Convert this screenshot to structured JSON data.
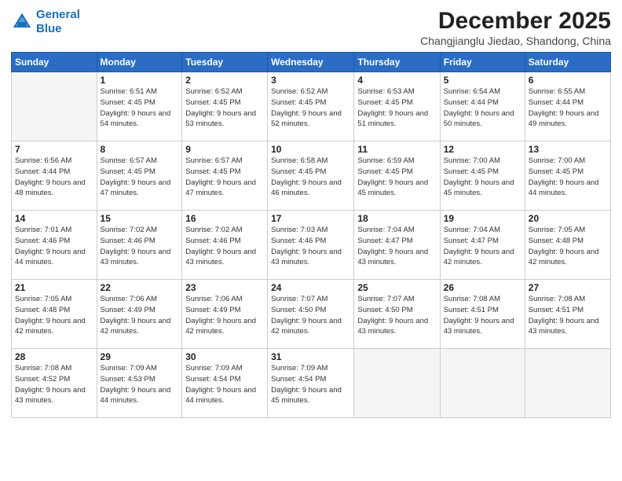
{
  "logo": {
    "line1": "General",
    "line2": "Blue"
  },
  "title": "December 2025",
  "subtitle": "Changjianglu Jiedao, Shandong, China",
  "days_header": [
    "Sunday",
    "Monday",
    "Tuesday",
    "Wednesday",
    "Thursday",
    "Friday",
    "Saturday"
  ],
  "weeks": [
    [
      {
        "day": "",
        "sunrise": "",
        "sunset": "",
        "daylight": ""
      },
      {
        "day": "1",
        "sunrise": "Sunrise: 6:51 AM",
        "sunset": "Sunset: 4:45 PM",
        "daylight": "Daylight: 9 hours and 54 minutes."
      },
      {
        "day": "2",
        "sunrise": "Sunrise: 6:52 AM",
        "sunset": "Sunset: 4:45 PM",
        "daylight": "Daylight: 9 hours and 53 minutes."
      },
      {
        "day": "3",
        "sunrise": "Sunrise: 6:52 AM",
        "sunset": "Sunset: 4:45 PM",
        "daylight": "Daylight: 9 hours and 52 minutes."
      },
      {
        "day": "4",
        "sunrise": "Sunrise: 6:53 AM",
        "sunset": "Sunset: 4:45 PM",
        "daylight": "Daylight: 9 hours and 51 minutes."
      },
      {
        "day": "5",
        "sunrise": "Sunrise: 6:54 AM",
        "sunset": "Sunset: 4:44 PM",
        "daylight": "Daylight: 9 hours and 50 minutes."
      },
      {
        "day": "6",
        "sunrise": "Sunrise: 6:55 AM",
        "sunset": "Sunset: 4:44 PM",
        "daylight": "Daylight: 9 hours and 49 minutes."
      }
    ],
    [
      {
        "day": "7",
        "sunrise": "Sunrise: 6:56 AM",
        "sunset": "Sunset: 4:44 PM",
        "daylight": "Daylight: 9 hours and 48 minutes."
      },
      {
        "day": "8",
        "sunrise": "Sunrise: 6:57 AM",
        "sunset": "Sunset: 4:45 PM",
        "daylight": "Daylight: 9 hours and 47 minutes."
      },
      {
        "day": "9",
        "sunrise": "Sunrise: 6:57 AM",
        "sunset": "Sunset: 4:45 PM",
        "daylight": "Daylight: 9 hours and 47 minutes."
      },
      {
        "day": "10",
        "sunrise": "Sunrise: 6:58 AM",
        "sunset": "Sunset: 4:45 PM",
        "daylight": "Daylight: 9 hours and 46 minutes."
      },
      {
        "day": "11",
        "sunrise": "Sunrise: 6:59 AM",
        "sunset": "Sunset: 4:45 PM",
        "daylight": "Daylight: 9 hours and 45 minutes."
      },
      {
        "day": "12",
        "sunrise": "Sunrise: 7:00 AM",
        "sunset": "Sunset: 4:45 PM",
        "daylight": "Daylight: 9 hours and 45 minutes."
      },
      {
        "day": "13",
        "sunrise": "Sunrise: 7:00 AM",
        "sunset": "Sunset: 4:45 PM",
        "daylight": "Daylight: 9 hours and 44 minutes."
      }
    ],
    [
      {
        "day": "14",
        "sunrise": "Sunrise: 7:01 AM",
        "sunset": "Sunset: 4:46 PM",
        "daylight": "Daylight: 9 hours and 44 minutes."
      },
      {
        "day": "15",
        "sunrise": "Sunrise: 7:02 AM",
        "sunset": "Sunset: 4:46 PM",
        "daylight": "Daylight: 9 hours and 43 minutes."
      },
      {
        "day": "16",
        "sunrise": "Sunrise: 7:02 AM",
        "sunset": "Sunset: 4:46 PM",
        "daylight": "Daylight: 9 hours and 43 minutes."
      },
      {
        "day": "17",
        "sunrise": "Sunrise: 7:03 AM",
        "sunset": "Sunset: 4:46 PM",
        "daylight": "Daylight: 9 hours and 43 minutes."
      },
      {
        "day": "18",
        "sunrise": "Sunrise: 7:04 AM",
        "sunset": "Sunset: 4:47 PM",
        "daylight": "Daylight: 9 hours and 43 minutes."
      },
      {
        "day": "19",
        "sunrise": "Sunrise: 7:04 AM",
        "sunset": "Sunset: 4:47 PM",
        "daylight": "Daylight: 9 hours and 42 minutes."
      },
      {
        "day": "20",
        "sunrise": "Sunrise: 7:05 AM",
        "sunset": "Sunset: 4:48 PM",
        "daylight": "Daylight: 9 hours and 42 minutes."
      }
    ],
    [
      {
        "day": "21",
        "sunrise": "Sunrise: 7:05 AM",
        "sunset": "Sunset: 4:48 PM",
        "daylight": "Daylight: 9 hours and 42 minutes."
      },
      {
        "day": "22",
        "sunrise": "Sunrise: 7:06 AM",
        "sunset": "Sunset: 4:49 PM",
        "daylight": "Daylight: 9 hours and 42 minutes."
      },
      {
        "day": "23",
        "sunrise": "Sunrise: 7:06 AM",
        "sunset": "Sunset: 4:49 PM",
        "daylight": "Daylight: 9 hours and 42 minutes."
      },
      {
        "day": "24",
        "sunrise": "Sunrise: 7:07 AM",
        "sunset": "Sunset: 4:50 PM",
        "daylight": "Daylight: 9 hours and 42 minutes."
      },
      {
        "day": "25",
        "sunrise": "Sunrise: 7:07 AM",
        "sunset": "Sunset: 4:50 PM",
        "daylight": "Daylight: 9 hours and 43 minutes."
      },
      {
        "day": "26",
        "sunrise": "Sunrise: 7:08 AM",
        "sunset": "Sunset: 4:51 PM",
        "daylight": "Daylight: 9 hours and 43 minutes."
      },
      {
        "day": "27",
        "sunrise": "Sunrise: 7:08 AM",
        "sunset": "Sunset: 4:51 PM",
        "daylight": "Daylight: 9 hours and 43 minutes."
      }
    ],
    [
      {
        "day": "28",
        "sunrise": "Sunrise: 7:08 AM",
        "sunset": "Sunset: 4:52 PM",
        "daylight": "Daylight: 9 hours and 43 minutes."
      },
      {
        "day": "29",
        "sunrise": "Sunrise: 7:09 AM",
        "sunset": "Sunset: 4:53 PM",
        "daylight": "Daylight: 9 hours and 44 minutes."
      },
      {
        "day": "30",
        "sunrise": "Sunrise: 7:09 AM",
        "sunset": "Sunset: 4:54 PM",
        "daylight": "Daylight: 9 hours and 44 minutes."
      },
      {
        "day": "31",
        "sunrise": "Sunrise: 7:09 AM",
        "sunset": "Sunset: 4:54 PM",
        "daylight": "Daylight: 9 hours and 45 minutes."
      },
      {
        "day": "",
        "sunrise": "",
        "sunset": "",
        "daylight": ""
      },
      {
        "day": "",
        "sunrise": "",
        "sunset": "",
        "daylight": ""
      },
      {
        "day": "",
        "sunrise": "",
        "sunset": "",
        "daylight": ""
      }
    ]
  ]
}
